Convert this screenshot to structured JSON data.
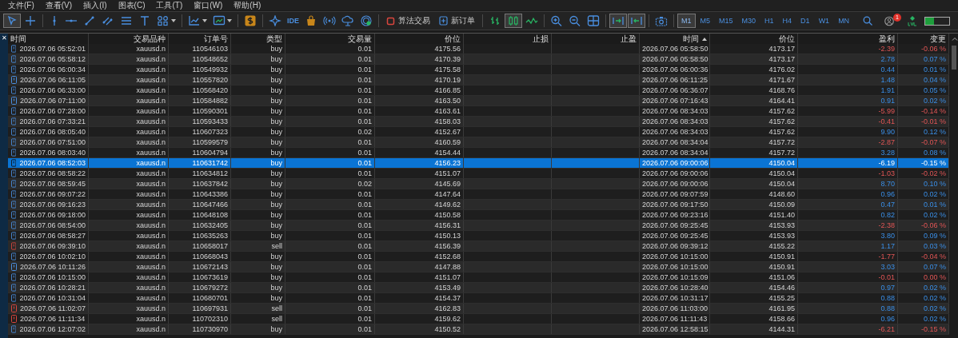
{
  "menu": [
    "文件(F)",
    "查看(V)",
    "插入(I)",
    "图表(C)",
    "工具(T)",
    "窗口(W)",
    "帮助(H)"
  ],
  "tools": [
    {
      "kind": "cursor",
      "selected": true
    },
    {
      "kind": "crosshair",
      "selected": false
    },
    {
      "kind": "sep"
    },
    {
      "kind": "vline",
      "selected": false
    },
    {
      "kind": "hline",
      "selected": false
    },
    {
      "kind": "trend",
      "selected": false
    },
    {
      "kind": "channel",
      "selected": false
    },
    {
      "kind": "fibo",
      "selected": false
    },
    {
      "kind": "text",
      "selected": false
    },
    {
      "kind": "shapes",
      "selected": false
    },
    {
      "kind": "sep"
    },
    {
      "kind": "indicators",
      "selected": false
    },
    {
      "kind": "templates",
      "selected": false
    },
    {
      "kind": "sep"
    },
    {
      "kind": "dollar",
      "selected": false
    },
    {
      "kind": "sep"
    },
    {
      "kind": "star",
      "selected": false
    },
    {
      "kind": "label",
      "label": "IDE",
      "selected": false
    },
    {
      "kind": "bag",
      "selected": false
    },
    {
      "kind": "signal",
      "selected": false
    },
    {
      "kind": "cloud",
      "selected": false
    },
    {
      "kind": "vps",
      "selected": false
    },
    {
      "kind": "sep"
    },
    {
      "kind": "algo",
      "label": "算法交易",
      "selected": false
    },
    {
      "kind": "order",
      "label": "新订单",
      "selected": false
    },
    {
      "kind": "sep"
    },
    {
      "kind": "bars",
      "selected": false
    },
    {
      "kind": "candles",
      "selected": true
    },
    {
      "kind": "line",
      "selected": false
    },
    {
      "kind": "sep"
    },
    {
      "kind": "zoomin",
      "selected": false
    },
    {
      "kind": "zoomout",
      "selected": false
    },
    {
      "kind": "grid",
      "selected": false
    },
    {
      "kind": "sep"
    },
    {
      "kind": "autoscroll",
      "selected": true
    },
    {
      "kind": "shift",
      "selected": true
    },
    {
      "kind": "sep"
    },
    {
      "kind": "camera",
      "selected": false
    },
    {
      "kind": "sep"
    }
  ],
  "timeframes": [
    {
      "label": "M1",
      "selected": true
    },
    {
      "label": "M5",
      "selected": false
    },
    {
      "label": "M15",
      "selected": false
    },
    {
      "label": "M30",
      "selected": false
    },
    {
      "label": "H1",
      "selected": false
    },
    {
      "label": "H4",
      "selected": false
    },
    {
      "label": "D1",
      "selected": false
    },
    {
      "label": "W1",
      "selected": false
    },
    {
      "label": "MN",
      "selected": false
    }
  ],
  "status": {
    "badge": "1",
    "level": 0.35
  },
  "close": "✕",
  "table": {
    "columns": [
      {
        "label": "时间"
      },
      {
        "label": "交易品种"
      },
      {
        "label": "订单号"
      },
      {
        "label": "类型"
      },
      {
        "label": "交易量"
      },
      {
        "label": "价位"
      },
      {
        "label": "止损"
      },
      {
        "label": "止盈"
      },
      {
        "label": "时间",
        "sorted": true
      },
      {
        "label": "价位"
      },
      {
        "label": "盈利"
      },
      {
        "label": "变更"
      }
    ],
    "rows": [
      {
        "kind": "buy",
        "loss": true,
        "selected": false,
        "cells": [
          "2026.07.06 05:52:01",
          "xauusd.n",
          "110546103",
          "buy",
          "0.01",
          "4175.56",
          "",
          "",
          "2026.07.06 05:58:50",
          "4173.17",
          "-2.39",
          "-0.06 %"
        ]
      },
      {
        "kind": "buy",
        "loss": false,
        "selected": false,
        "cells": [
          "2026.07.06 05:58:12",
          "xauusd.n",
          "110548652",
          "buy",
          "0.01",
          "4170.39",
          "",
          "",
          "2026.07.06 05:58:50",
          "4173.17",
          "2.78",
          "0.07 %"
        ]
      },
      {
        "kind": "buy",
        "loss": false,
        "selected": false,
        "cells": [
          "2026.07.06 06:00:34",
          "xauusd.n",
          "110549932",
          "buy",
          "0.01",
          "4175.58",
          "",
          "",
          "2026.07.06 06:00:36",
          "4176.02",
          "0.44",
          "0.01 %"
        ]
      },
      {
        "kind": "buy",
        "loss": false,
        "selected": false,
        "cells": [
          "2026.07.06 06:11:05",
          "xauusd.n",
          "110557820",
          "buy",
          "0.01",
          "4170.19",
          "",
          "",
          "2026.07.06 06:11:25",
          "4171.67",
          "1.48",
          "0.04 %"
        ]
      },
      {
        "kind": "buy",
        "loss": false,
        "selected": false,
        "cells": [
          "2026.07.06 06:33:00",
          "xauusd.n",
          "110568420",
          "buy",
          "0.01",
          "4166.85",
          "",
          "",
          "2026.07.06 06:36:07",
          "4168.76",
          "1.91",
          "0.05 %"
        ]
      },
      {
        "kind": "buy",
        "loss": false,
        "selected": false,
        "cells": [
          "2026.07.06 07:11:00",
          "xauusd.n",
          "110584882",
          "buy",
          "0.01",
          "4163.50",
          "",
          "",
          "2026.07.06 07:16:43",
          "4164.41",
          "0.91",
          "0.02 %"
        ]
      },
      {
        "kind": "buy",
        "loss": true,
        "selected": false,
        "cells": [
          "2026.07.06 07:28:00",
          "xauusd.n",
          "110590301",
          "buy",
          "0.01",
          "4163.61",
          "",
          "",
          "2026.07.06 08:34:03",
          "4157.62",
          "-5.99",
          "-0.14 %"
        ]
      },
      {
        "kind": "buy",
        "loss": true,
        "selected": false,
        "cells": [
          "2026.07.06 07:33:21",
          "xauusd.n",
          "110593433",
          "buy",
          "0.01",
          "4158.03",
          "",
          "",
          "2026.07.06 08:34:03",
          "4157.62",
          "-0.41",
          "-0.01 %"
        ]
      },
      {
        "kind": "buy",
        "loss": false,
        "selected": false,
        "cells": [
          "2026.07.06 08:05:40",
          "xauusd.n",
          "110607323",
          "buy",
          "0.02",
          "4152.67",
          "",
          "",
          "2026.07.06 08:34:03",
          "4157.62",
          "9.90",
          "0.12 %"
        ]
      },
      {
        "kind": "buy",
        "loss": true,
        "selected": false,
        "cells": [
          "2026.07.06 07:51:00",
          "xauusd.n",
          "110599579",
          "buy",
          "0.01",
          "4160.59",
          "",
          "",
          "2026.07.06 08:34:04",
          "4157.72",
          "-2.87",
          "-0.07 %"
        ]
      },
      {
        "kind": "buy",
        "loss": false,
        "selected": false,
        "cells": [
          "2026.07.06 08:03:40",
          "xauusd.n",
          "110604794",
          "buy",
          "0.01",
          "4154.44",
          "",
          "",
          "2026.07.06 08:34:04",
          "4157.72",
          "3.28",
          "0.08 %"
        ]
      },
      {
        "kind": "buy",
        "selected": true,
        "cells": [
          "2026.07.06 08:52:03",
          "xauusd.n",
          "110631742",
          "buy",
          "0.01",
          "4156.23",
          "",
          "",
          "2026.07.06 09:00:06",
          "4150.04",
          "-6.19",
          "-0.15 %"
        ]
      },
      {
        "kind": "buy",
        "loss": true,
        "selected": false,
        "cells": [
          "2026.07.06 08:58:22",
          "xauusd.n",
          "110634812",
          "buy",
          "0.01",
          "4151.07",
          "",
          "",
          "2026.07.06 09:00:06",
          "4150.04",
          "-1.03",
          "-0.02 %"
        ]
      },
      {
        "kind": "buy",
        "loss": false,
        "selected": false,
        "cells": [
          "2026.07.06 08:59:45",
          "xauusd.n",
          "110637842",
          "buy",
          "0.02",
          "4145.69",
          "",
          "",
          "2026.07.06 09:00:06",
          "4150.04",
          "8.70",
          "0.10 %"
        ]
      },
      {
        "kind": "buy",
        "loss": false,
        "selected": false,
        "cells": [
          "2026.07.06 09:07:22",
          "xauusd.n",
          "110643386",
          "buy",
          "0.01",
          "4147.64",
          "",
          "",
          "2026.07.06 09:07:59",
          "4148.60",
          "0.96",
          "0.02 %"
        ]
      },
      {
        "kind": "buy",
        "loss": false,
        "selected": false,
        "cells": [
          "2026.07.06 09:16:23",
          "xauusd.n",
          "110647466",
          "buy",
          "0.01",
          "4149.62",
          "",
          "",
          "2026.07.06 09:17:50",
          "4150.09",
          "0.47",
          "0.01 %"
        ]
      },
      {
        "kind": "buy",
        "loss": false,
        "selected": false,
        "cells": [
          "2026.07.06 09:18:00",
          "xauusd.n",
          "110648108",
          "buy",
          "0.01",
          "4150.58",
          "",
          "",
          "2026.07.06 09:23:16",
          "4151.40",
          "0.82",
          "0.02 %"
        ]
      },
      {
        "kind": "buy",
        "loss": true,
        "selected": false,
        "cells": [
          "2026.07.06 08:54:00",
          "xauusd.n",
          "110632405",
          "buy",
          "0.01",
          "4156.31",
          "",
          "",
          "2026.07.06 09:25:45",
          "4153.93",
          "-2.38",
          "-0.06 %"
        ]
      },
      {
        "kind": "buy",
        "loss": false,
        "selected": false,
        "cells": [
          "2026.07.06 08:58:27",
          "xauusd.n",
          "110635263",
          "buy",
          "0.01",
          "4150.13",
          "",
          "",
          "2026.07.06 09:25:45",
          "4153.93",
          "3.80",
          "0.09 %"
        ]
      },
      {
        "kind": "sell",
        "loss": false,
        "selected": false,
        "cells": [
          "2026.07.06 09:39:10",
          "xauusd.n",
          "110658017",
          "sell",
          "0.01",
          "4156.39",
          "",
          "",
          "2026.07.06 09:39:12",
          "4155.22",
          "1.17",
          "0.03 %"
        ]
      },
      {
        "kind": "buy",
        "loss": true,
        "selected": false,
        "cells": [
          "2026.07.06 10:02:10",
          "xauusd.n",
          "110668043",
          "buy",
          "0.01",
          "4152.68",
          "",
          "",
          "2026.07.06 10:15:00",
          "4150.91",
          "-1.77",
          "-0.04 %"
        ]
      },
      {
        "kind": "buy",
        "loss": false,
        "selected": false,
        "cells": [
          "2026.07.06 10:11:26",
          "xauusd.n",
          "110672143",
          "buy",
          "0.01",
          "4147.88",
          "",
          "",
          "2026.07.06 10:15:00",
          "4150.91",
          "3.03",
          "0.07 %"
        ]
      },
      {
        "kind": "buy",
        "loss": true,
        "selected": false,
        "cells": [
          "2026.07.06 10:15:00",
          "xauusd.n",
          "110673619",
          "buy",
          "0.01",
          "4151.07",
          "",
          "",
          "2026.07.06 10:15:09",
          "4151.06",
          "-0.01",
          "0.00 %"
        ]
      },
      {
        "kind": "buy",
        "loss": false,
        "selected": false,
        "cells": [
          "2026.07.06 10:28:21",
          "xauusd.n",
          "110679272",
          "buy",
          "0.01",
          "4153.49",
          "",
          "",
          "2026.07.06 10:28:40",
          "4154.46",
          "0.97",
          "0.02 %"
        ]
      },
      {
        "kind": "buy",
        "loss": false,
        "selected": false,
        "cells": [
          "2026.07.06 10:31:04",
          "xauusd.n",
          "110680701",
          "buy",
          "0.01",
          "4154.37",
          "",
          "",
          "2026.07.06 10:31:17",
          "4155.25",
          "0.88",
          "0.02 %"
        ]
      },
      {
        "kind": "sell",
        "loss": false,
        "selected": false,
        "cells": [
          "2026.07.06 11:02:07",
          "xauusd.n",
          "110697931",
          "sell",
          "0.01",
          "4162.83",
          "",
          "",
          "2026.07.06 11:03:00",
          "4161.95",
          "0.88",
          "0.02 %"
        ]
      },
      {
        "kind": "sell",
        "loss": false,
        "selected": false,
        "cells": [
          "2026.07.06 11:11:34",
          "xauusd.n",
          "110702310",
          "sell",
          "0.01",
          "4159.62",
          "",
          "",
          "2026.07.06 11:11:43",
          "4158.66",
          "0.96",
          "0.02 %"
        ]
      },
      {
        "kind": "buy",
        "loss": true,
        "selected": false,
        "cells": [
          "2026.07.06 12:07:02",
          "xauusd.n",
          "110730970",
          "buy",
          "0.01",
          "4150.52",
          "",
          "",
          "2026.07.06 12:58:15",
          "4144.31",
          "-6.21",
          "-0.15 %"
        ]
      }
    ]
  }
}
